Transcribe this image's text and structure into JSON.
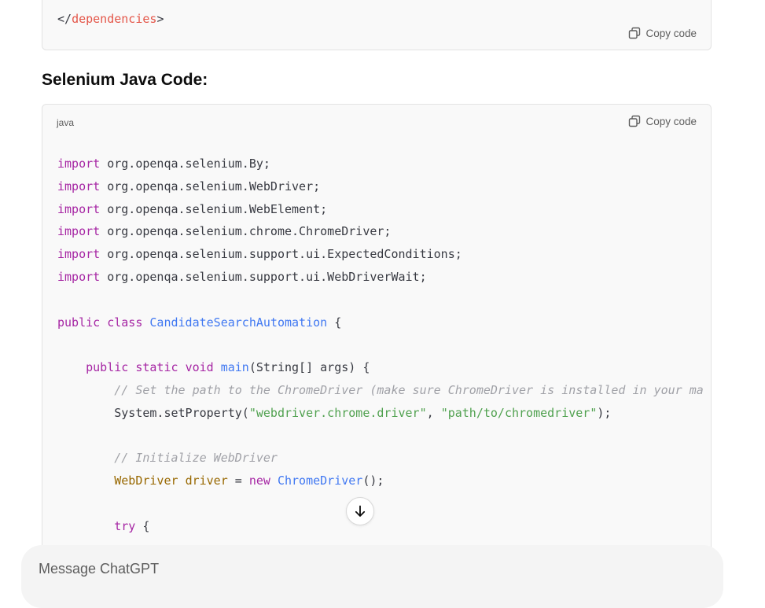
{
  "previous_block": {
    "code_line": [
      {
        "t": "</",
        "c": ""
      },
      {
        "t": "dependencies",
        "c": "tag"
      },
      {
        "t": ">",
        "c": ""
      }
    ],
    "copy_label": "Copy code"
  },
  "section": {
    "heading": "Selenium Java Code:"
  },
  "code_block": {
    "language": "java",
    "copy_label": "Copy code",
    "lines": [
      [
        {
          "t": "import",
          "c": "kw"
        },
        {
          "t": " org.openqa.selenium.By;",
          "c": ""
        }
      ],
      [
        {
          "t": "import",
          "c": "kw"
        },
        {
          "t": " org.openqa.selenium.WebDriver;",
          "c": ""
        }
      ],
      [
        {
          "t": "import",
          "c": "kw"
        },
        {
          "t": " org.openqa.selenium.WebElement;",
          "c": ""
        }
      ],
      [
        {
          "t": "import",
          "c": "kw"
        },
        {
          "t": " org.openqa.selenium.chrome.ChromeDriver;",
          "c": ""
        }
      ],
      [
        {
          "t": "import",
          "c": "kw"
        },
        {
          "t": " org.openqa.selenium.support.ui.ExpectedConditions;",
          "c": ""
        }
      ],
      [
        {
          "t": "import",
          "c": "kw"
        },
        {
          "t": " org.openqa.selenium.support.ui.WebDriverWait;",
          "c": ""
        }
      ],
      [],
      [
        {
          "t": "public",
          "c": "kw"
        },
        {
          "t": " ",
          "c": ""
        },
        {
          "t": "class",
          "c": "kw"
        },
        {
          "t": " ",
          "c": ""
        },
        {
          "t": "CandidateSearchAutomation",
          "c": "cls"
        },
        {
          "t": " {",
          "c": ""
        }
      ],
      [],
      [
        {
          "t": "    ",
          "c": ""
        },
        {
          "t": "public",
          "c": "kw"
        },
        {
          "t": " ",
          "c": ""
        },
        {
          "t": "static",
          "c": "kw"
        },
        {
          "t": " ",
          "c": ""
        },
        {
          "t": "void",
          "c": "kw"
        },
        {
          "t": " ",
          "c": ""
        },
        {
          "t": "main",
          "c": "cls"
        },
        {
          "t": "(String[] args) {",
          "c": ""
        }
      ],
      [
        {
          "t": "        ",
          "c": ""
        },
        {
          "t": "// Set the path to the ChromeDriver (make sure ChromeDriver is installed in your ma",
          "c": "cmt"
        }
      ],
      [
        {
          "t": "        System.setProperty(",
          "c": ""
        },
        {
          "t": "\"webdriver.chrome.driver\"",
          "c": "str"
        },
        {
          "t": ", ",
          "c": ""
        },
        {
          "t": "\"path/to/chromedriver\"",
          "c": "str"
        },
        {
          "t": ");",
          "c": ""
        }
      ],
      [],
      [
        {
          "t": "        ",
          "c": ""
        },
        {
          "t": "// Initialize WebDriver",
          "c": "cmt"
        }
      ],
      [
        {
          "t": "        ",
          "c": ""
        },
        {
          "t": "WebDriver",
          "c": "type"
        },
        {
          "t": " ",
          "c": ""
        },
        {
          "t": "driver",
          "c": "type"
        },
        {
          "t": " = ",
          "c": ""
        },
        {
          "t": "new",
          "c": "kw"
        },
        {
          "t": " ",
          "c": ""
        },
        {
          "t": "ChromeDriver",
          "c": "cls"
        },
        {
          "t": "();",
          "c": ""
        }
      ],
      [],
      [
        {
          "t": "        ",
          "c": ""
        },
        {
          "t": "try",
          "c": "kw"
        },
        {
          "t": " {",
          "c": ""
        }
      ]
    ]
  },
  "scroll_button": {
    "icon": "arrow-down-icon"
  },
  "composer": {
    "placeholder": "Message ChatGPT"
  },
  "colors": {
    "keyword": "#a626a4",
    "class_name": "#4078f2",
    "type": "#986801",
    "string": "#50a14f",
    "comment": "#a0a1a7",
    "tag": "#e45649"
  }
}
